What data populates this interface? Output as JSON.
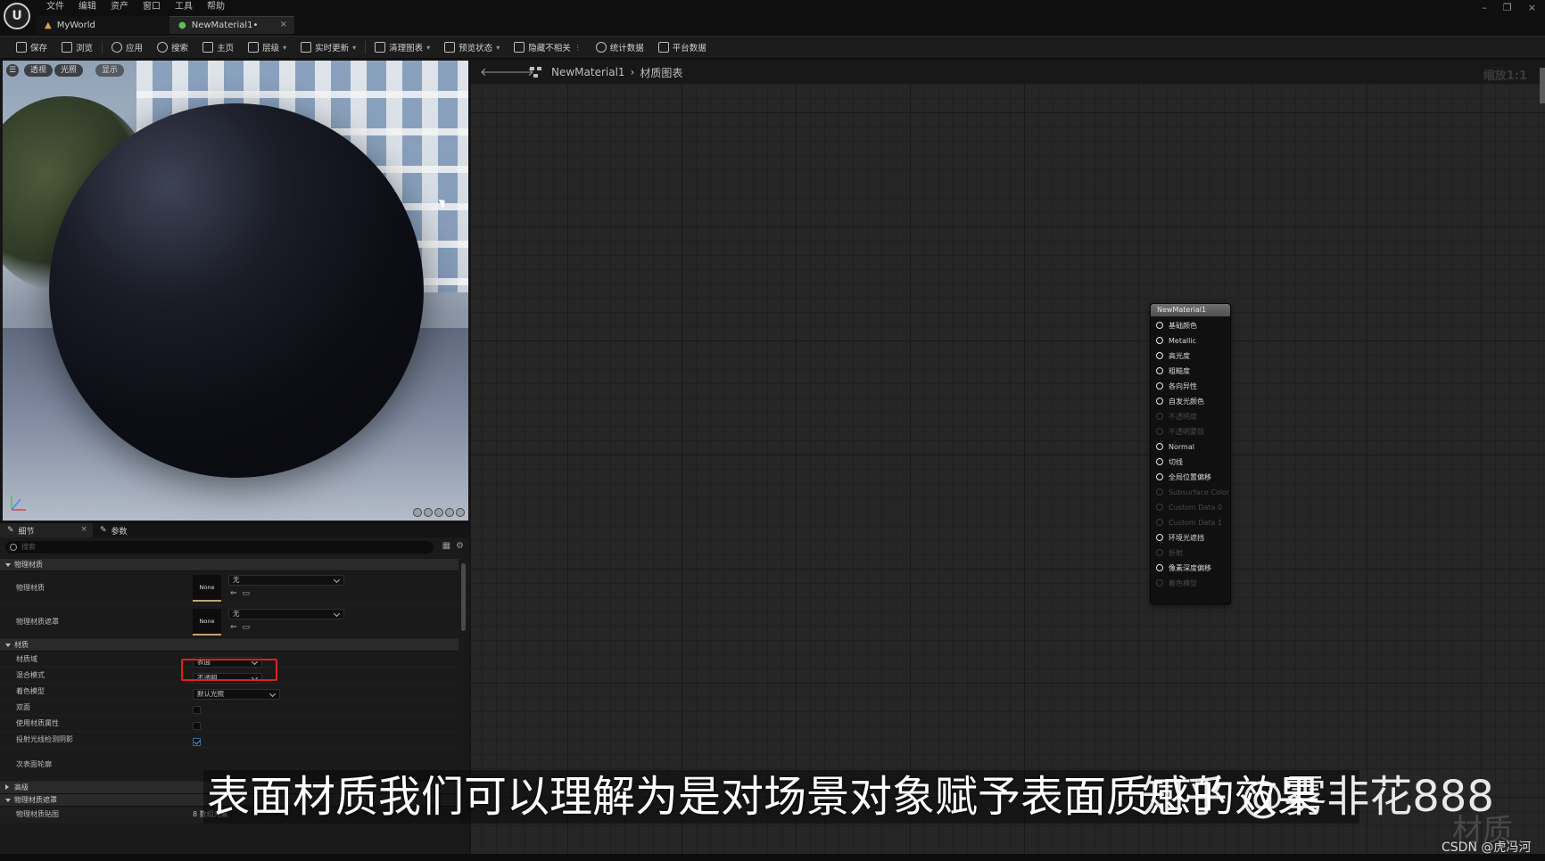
{
  "app": {
    "logo_letter": "U",
    "menu": [
      "文件",
      "编辑",
      "资产",
      "窗口",
      "工具",
      "帮助"
    ],
    "tabs": [
      {
        "label": "MyWorld"
      },
      {
        "label": "NewMaterial1•",
        "close": "×"
      }
    ],
    "window_controls": [
      "–",
      "❐",
      "×"
    ]
  },
  "toolbar": {
    "items": [
      {
        "label": "保存"
      },
      {
        "label": "浏览"
      },
      {
        "label": "应用"
      },
      {
        "label": "搜索"
      },
      {
        "label": "主页"
      },
      {
        "label": "层级",
        "has_caret": true
      },
      {
        "label": "实时更新",
        "has_caret": true
      },
      {
        "label": "清理图表",
        "has_caret": true
      },
      {
        "label": "预览状态",
        "has_caret": true
      },
      {
        "label": "隐藏不相关"
      },
      {
        "label": "统计数据"
      },
      {
        "label": "平台数据"
      }
    ]
  },
  "viewport": {
    "menu_glyph": "☰",
    "chips": [
      "透视",
      "光照",
      "显示"
    ]
  },
  "details": {
    "tabs": [
      {
        "label": "细节",
        "close": "×"
      },
      {
        "label": "参数"
      }
    ],
    "search_placeholder": "搜索",
    "sections": {
      "physical_material": "物理材质",
      "material": "材质",
      "advanced": "高级",
      "physical_material_mask": "物理材质遮罩",
      "physical_material_map": "物理材质贴图"
    },
    "rows": {
      "phys_mat_label": "物理材质",
      "phys_mat_thumb": "None",
      "phys_mat_value": "无",
      "phys_mask_label": "物理材质遮罩",
      "phys_mask_thumb": "None",
      "phys_mask_value": "无",
      "domain_label": "材质域",
      "domain_value": "表面",
      "blend_label": "混合模式",
      "blend_value": "不透明",
      "shading_label": "着色模型",
      "shading_value": "默认光照",
      "two_sided_label": "双面",
      "use_attr_label": "使用材质属性",
      "ray_shadow_label": "投射光线检测阴影",
      "subsurface_label": "次表面轮廓",
      "map_value": "8 数组元素"
    }
  },
  "graph": {
    "breadcrumb": [
      "NewMaterial1",
      "材质图表"
    ],
    "zoom": "缩放1:1",
    "node": {
      "title": "NewMaterial1",
      "pins": [
        {
          "label": "基础颜色",
          "enabled": true
        },
        {
          "label": "Metallic",
          "enabled": true
        },
        {
          "label": "高光度",
          "enabled": true
        },
        {
          "label": "粗糙度",
          "enabled": true
        },
        {
          "label": "各向异性",
          "enabled": true
        },
        {
          "label": "自发光颜色",
          "enabled": true
        },
        {
          "label": "不透明度",
          "enabled": false
        },
        {
          "label": "不透明蒙版",
          "enabled": false
        },
        {
          "label": "Normal",
          "enabled": true
        },
        {
          "label": "切线",
          "enabled": true
        },
        {
          "label": "全局位置偏移",
          "enabled": true
        },
        {
          "label": "Subsurface Color",
          "enabled": false
        },
        {
          "label": "Custom Data 0",
          "enabled": false
        },
        {
          "label": "Custom Data 1",
          "enabled": false
        },
        {
          "label": "环境光遮挡",
          "enabled": true
        },
        {
          "label": "折射",
          "enabled": false
        },
        {
          "label": "像素深度偏移",
          "enabled": true
        },
        {
          "label": "着色模型",
          "enabled": false
        }
      ]
    }
  },
  "overlay": {
    "subtitle": "表面材质我们可以理解为是对场景对象赋予表面质感的效果",
    "subtitle_overlap": "知乎 @雾非花888",
    "watermark": "材质",
    "credit": "CSDN @虎冯河"
  },
  "colors": {
    "highlight_box": "#e02020",
    "accent_blue": "#3b6ea8"
  }
}
